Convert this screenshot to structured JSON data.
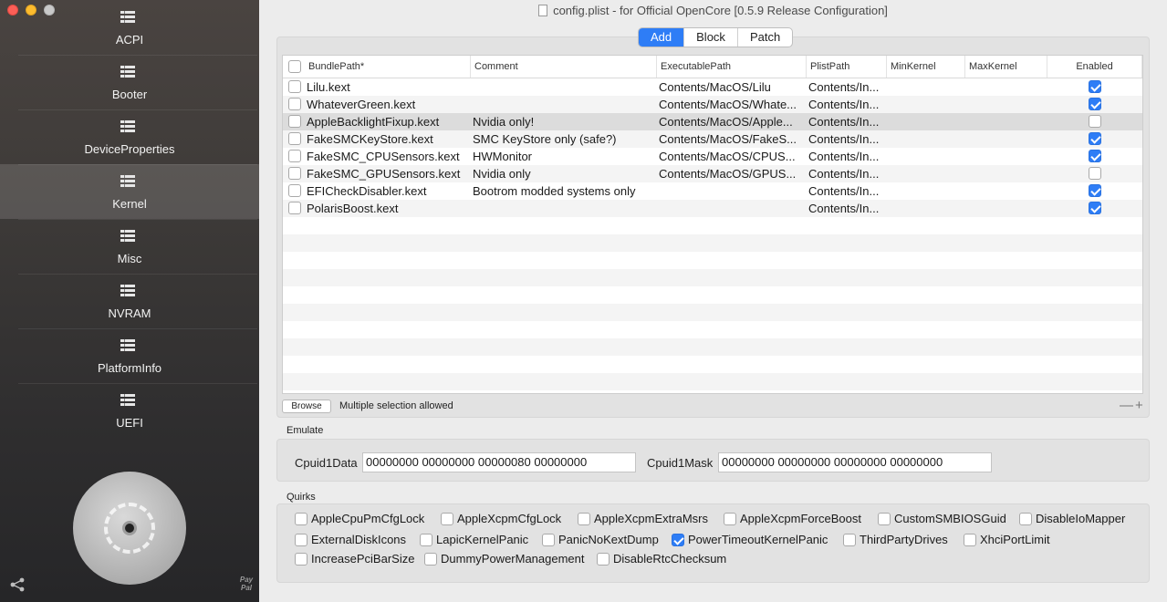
{
  "window": {
    "title": "config.plist - for Official OpenCore [0.5.9 Release Configuration]"
  },
  "sidebar": {
    "items": [
      {
        "label": "ACPI",
        "selected": false
      },
      {
        "label": "Booter",
        "selected": false
      },
      {
        "label": "DeviceProperties",
        "selected": false
      },
      {
        "label": "Kernel",
        "selected": true
      },
      {
        "label": "Misc",
        "selected": false
      },
      {
        "label": "NVRAM",
        "selected": false
      },
      {
        "label": "PlatformInfo",
        "selected": false
      },
      {
        "label": "UEFI",
        "selected": false
      }
    ],
    "paypal_text": "Pay Pal"
  },
  "kernel": {
    "segments": [
      "Add",
      "Block",
      "Patch"
    ],
    "active_segment": "Add",
    "columns": [
      "BundlePath*",
      "Comment",
      "ExecutablePath",
      "PlistPath",
      "MinKernel",
      "MaxKernel",
      "Enabled"
    ],
    "rows": [
      {
        "bundle": "Lilu.kext",
        "comment": "",
        "exec": "Contents/MacOS/Lilu",
        "plist": "Contents/In...",
        "min": "",
        "max": "",
        "enabled": true,
        "selected": false
      },
      {
        "bundle": "WhateverGreen.kext",
        "comment": "",
        "exec": "Contents/MacOS/Whate...",
        "plist": "Contents/In...",
        "min": "",
        "max": "",
        "enabled": true,
        "selected": false
      },
      {
        "bundle": "AppleBacklightFixup.kext",
        "comment": "Nvidia only!",
        "exec": "Contents/MacOS/Apple...",
        "plist": "Contents/In...",
        "min": "",
        "max": "",
        "enabled": false,
        "selected": true
      },
      {
        "bundle": "FakeSMCKeyStore.kext",
        "comment": "SMC KeyStore only (safe?)",
        "exec": "Contents/MacOS/FakeS...",
        "plist": "Contents/In...",
        "min": "",
        "max": "",
        "enabled": true,
        "selected": false
      },
      {
        "bundle": "FakeSMC_CPUSensors.kext",
        "comment": "HWMonitor",
        "exec": "Contents/MacOS/CPUS...",
        "plist": "Contents/In...",
        "min": "",
        "max": "",
        "enabled": true,
        "selected": false
      },
      {
        "bundle": "FakeSMC_GPUSensors.kext",
        "comment": "Nvidia only",
        "exec": "Contents/MacOS/GPUS...",
        "plist": "Contents/In...",
        "min": "",
        "max": "",
        "enabled": false,
        "selected": false
      },
      {
        "bundle": "EFICheckDisabler.kext",
        "comment": "Bootrom modded systems only",
        "exec": "",
        "plist": "Contents/In...",
        "min": "",
        "max": "",
        "enabled": true,
        "selected": false
      },
      {
        "bundle": "PolarisBoost.kext",
        "comment": "",
        "exec": "",
        "plist": "Contents/In...",
        "min": "",
        "max": "",
        "enabled": true,
        "selected": false
      }
    ],
    "empty_rows": 10,
    "browse_label": "Browse",
    "multi_selection_text": "Multiple selection allowed",
    "remove_add_symbols": "—+"
  },
  "emulate": {
    "title": "Emulate",
    "cpuid1data_label": "Cpuid1Data",
    "cpuid1data_value": "00000000 00000000 00000080 00000000",
    "cpuid1mask_label": "Cpuid1Mask",
    "cpuid1mask_value": "00000000 00000000 00000000 00000000"
  },
  "quirks": {
    "title": "Quirks",
    "items": [
      {
        "label": "AppleCpuPmCfgLock",
        "checked": false
      },
      {
        "label": "AppleXcpmCfgLock",
        "checked": false
      },
      {
        "label": "AppleXcpmExtraMsrs",
        "checked": false
      },
      {
        "label": "AppleXcpmForceBoost",
        "checked": false
      },
      {
        "label": "CustomSMBIOSGuid",
        "checked": false
      },
      {
        "label": "DisableIoMapper",
        "checked": false
      },
      {
        "label": "ExternalDiskIcons",
        "checked": false
      },
      {
        "label": "LapicKernelPanic",
        "checked": false
      },
      {
        "label": "PanicNoKextDump",
        "checked": false
      },
      {
        "label": "PowerTimeoutKernelPanic",
        "checked": true
      },
      {
        "label": "ThirdPartyDrives",
        "checked": false
      },
      {
        "label": "XhciPortLimit",
        "checked": false
      },
      {
        "label": "IncreasePciBarSize",
        "checked": false
      },
      {
        "label": "DummyPowerManagement",
        "checked": false
      },
      {
        "label": "DisableRtcChecksum",
        "checked": false
      }
    ]
  },
  "colors": {
    "accent": "#2e7df6",
    "sidebar_top": "#4a4441",
    "sidebar_bottom": "#262628"
  }
}
